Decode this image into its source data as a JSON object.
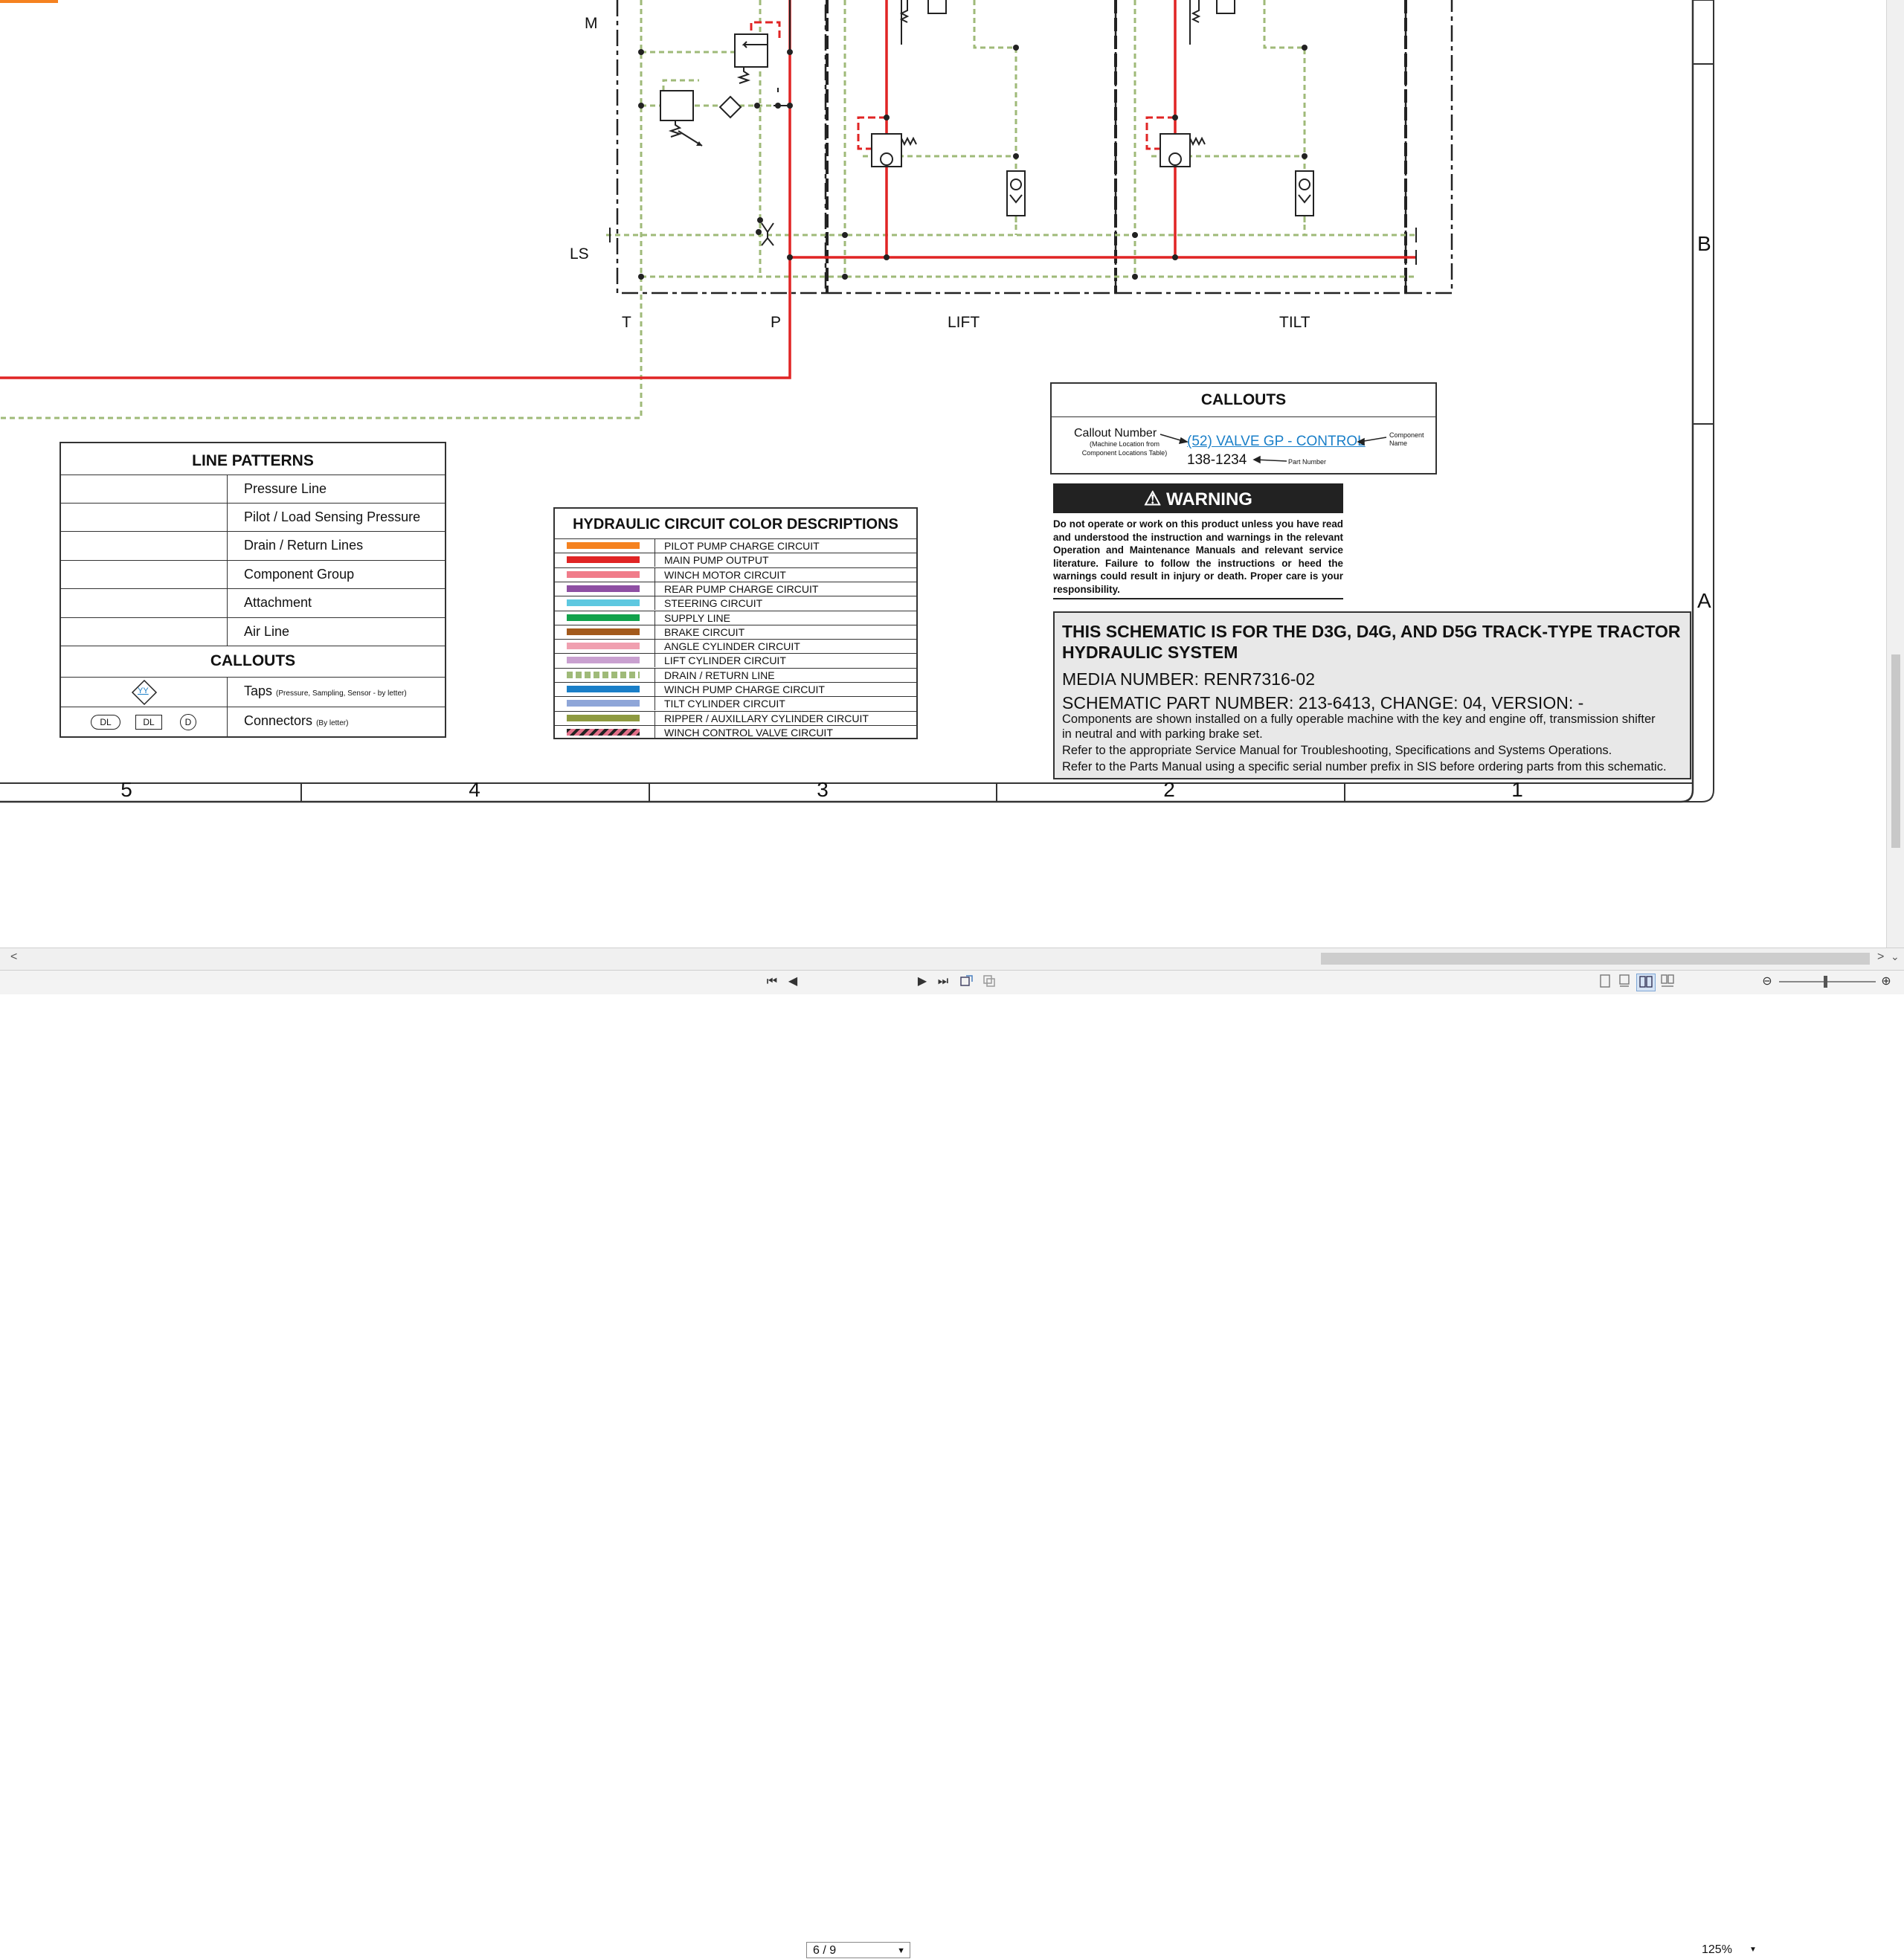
{
  "colors": {
    "pressure_red": "#e02424",
    "drain_green": "#9fba78",
    "link_blue": "#1a7fc8",
    "warning_bg": "#222222",
    "title_box_bg": "#e8e8e8",
    "accent_orange": "#f58220"
  },
  "diagram": {
    "labels": {
      "m": "M",
      "ls": "LS",
      "t": "T",
      "p": "P",
      "lift": "LIFT",
      "tilt": "TILT"
    },
    "side_letters": [
      "B",
      "A"
    ],
    "zone_numbers": [
      "5",
      "4",
      "3",
      "2",
      "1"
    ]
  },
  "line_patterns": {
    "title": "LINE PATTERNS",
    "rows": [
      {
        "label": "Pressure Line",
        "style": "solid"
      },
      {
        "label": "Pilot / Load Sensing Pressure",
        "style": "long-dash"
      },
      {
        "label": "Drain / Return Lines",
        "style": "short-dash"
      },
      {
        "label": "Component Group",
        "style": "dash-dot"
      },
      {
        "label": "Attachment",
        "style": "dash-long-dash"
      },
      {
        "label": "Air Line",
        "style": "fine-dash"
      }
    ],
    "callouts_title": "CALLOUTS",
    "taps_label": "Taps",
    "taps_note": "(Pressure, Sampling, Sensor - by letter)",
    "taps_symbol": "YY",
    "connectors_label": "Connectors",
    "connectors_note": "(By letter)",
    "connector_symbols": [
      "DL",
      "DL",
      "D"
    ]
  },
  "color_descriptions": {
    "title": "HYDRAULIC CIRCUIT COLOR DESCRIPTIONS",
    "rows": [
      {
        "label": "PILOT PUMP CHARGE CIRCUIT",
        "color": "#f58220"
      },
      {
        "label": "MAIN PUMP OUTPUT",
        "color": "#e02424"
      },
      {
        "label": "WINCH MOTOR CIRCUIT",
        "color": "#f07c8a"
      },
      {
        "label": "REAR PUMP CHARGE CIRCUIT",
        "color": "#8e4fa3"
      },
      {
        "label": "STEERING CIRCUIT",
        "color": "#5ec8e0"
      },
      {
        "label": "SUPPLY LINE",
        "color": "#12a24b"
      },
      {
        "label": "BRAKE CIRCUIT",
        "color": "#a35a1c"
      },
      {
        "label": "ANGLE CYLINDER CIRCUIT",
        "color": "#f0a0b0"
      },
      {
        "label": "LIFT CYLINDER CIRCUIT",
        "color": "#c9a0d0"
      },
      {
        "label": "DRAIN / RETURN LINE",
        "color": "#9fba78"
      },
      {
        "label": "WINCH PUMP CHARGE CIRCUIT",
        "color": "#1a7fc8"
      },
      {
        "label": "TILT CYLINDER CIRCUIT",
        "color": "#8fa6d8"
      },
      {
        "label": "RIPPER / AUXILLARY CYLINDER CIRCUIT",
        "color": "#8e9a40"
      },
      {
        "label": "WINCH CONTROL VALVE CIRCUIT",
        "color": "#e2718a"
      }
    ]
  },
  "callout_example": {
    "title": "CALLOUTS",
    "callout_number_label": "Callout Number",
    "callout_number_note_1": "(Machine Location from",
    "callout_number_note_2": "Component Locations Table)",
    "link_text": "(52) VALVE GP - CONTROL",
    "component_name_1": "Component",
    "component_name_2": "Name",
    "part_value": "138-1234",
    "part_number_label": "Part Number"
  },
  "warning": {
    "heading": "WARNING",
    "text": "Do not operate or work on this product unless you have read and understood the instruction and warnings in the relevant Operation and Maintenance Manuals and relevant service literature. Failure to follow the instructions or heed the warnings could result in injury or death. Proper care is your responsibility."
  },
  "title_block": {
    "line1": "THIS SCHEMATIC IS FOR THE D3G, D4G, AND D5G TRACK-TYPE TRACTOR",
    "line2": "HYDRAULIC SYSTEM",
    "media": "MEDIA NUMBER: RENR7316-02",
    "part": "SCHEMATIC PART NUMBER: 213-6413, CHANGE: 04, VERSION: -",
    "note1": "Components are shown installed on a fully operable machine with the key and engine off, transmission shifter",
    "note2": "in neutral and with parking brake set.",
    "note3": "Refer to the appropriate Service Manual for Troubleshooting, Specifications and Systems Operations.",
    "note4": "Refer to the Parts Manual using a specific serial number prefix in SIS before ordering parts from this schematic."
  },
  "viewer": {
    "page_indicator": "6 / 9",
    "zoom": "125%",
    "scroll_left_arrow": "<",
    "scroll_right_arrow": ">",
    "nav_first": "⏮",
    "nav_prev": "◀",
    "nav_next": "▶",
    "nav_last": "⏭"
  }
}
